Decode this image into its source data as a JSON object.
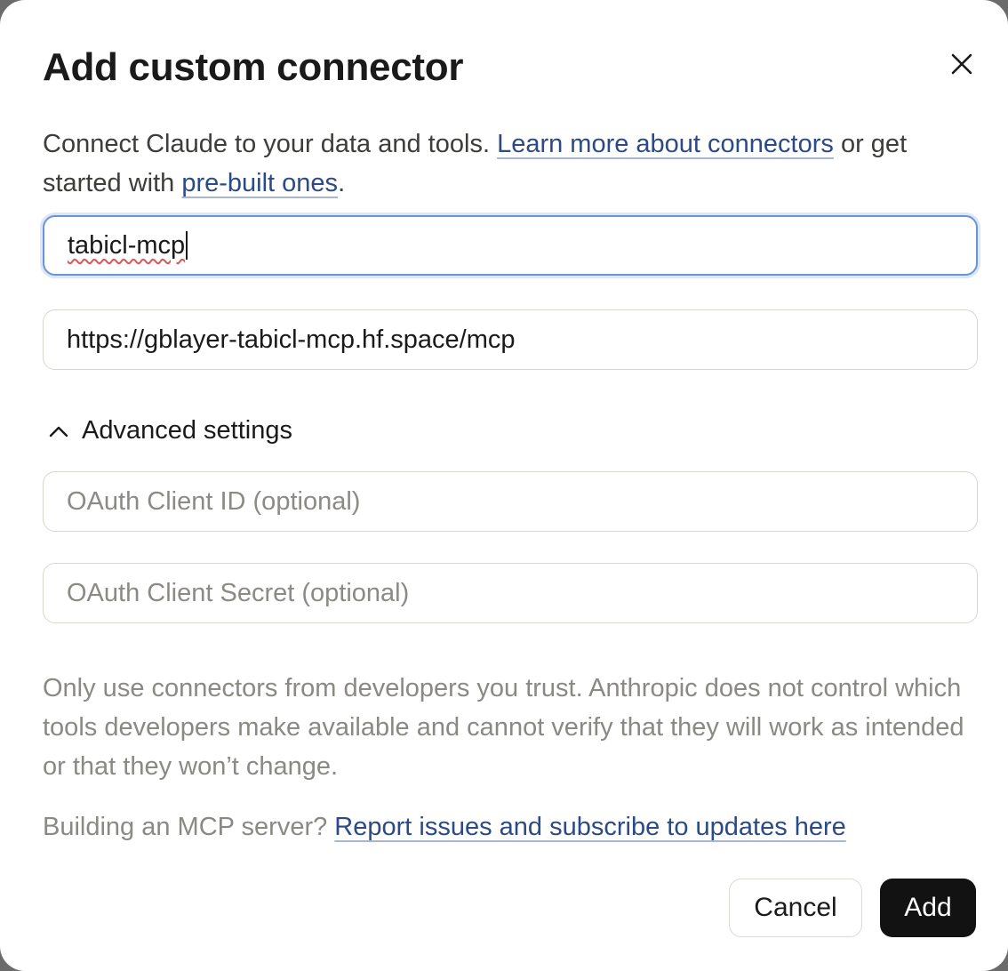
{
  "dialog": {
    "title": "Add custom connector",
    "intro": {
      "text_before": "Connect Claude to your data and tools. ",
      "link_learn": "Learn more about connectors",
      "text_middle": " or get started with ",
      "link_prebuilt": "pre-built ones",
      "text_after": "."
    },
    "name_field": {
      "value": "tabicl-mcp"
    },
    "url_field": {
      "value": "https://gblayer-tabicl-mcp.hf.space/mcp"
    },
    "advanced": {
      "label": "Advanced settings",
      "expanded": true,
      "client_id_placeholder": "OAuth Client ID (optional)",
      "client_secret_placeholder": "OAuth Client Secret (optional)"
    },
    "warning": "Only use connectors from developers you trust. Anthropic does not control which tools developers make available and cannot verify that they will work as intended or that they won’t change.",
    "build": {
      "text": "Building an MCP server? ",
      "link": "Report issues and subscribe to updates here"
    },
    "buttons": {
      "cancel": "Cancel",
      "add": "Add"
    },
    "icons": {
      "close": "close-icon",
      "chevron": "chevron-up-icon"
    },
    "colors": {
      "link": "#2b4a86",
      "focus_border": "#6a94d8",
      "primary_button": "#121212"
    }
  }
}
